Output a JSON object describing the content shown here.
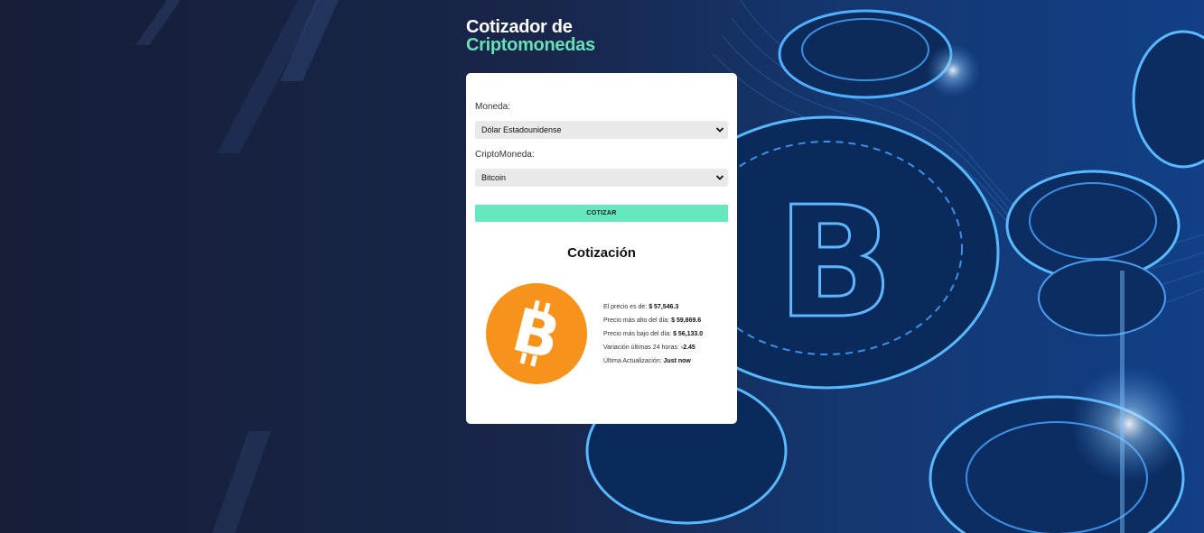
{
  "header": {
    "title_line1": "Cotizador de",
    "title_line2": "Criptomonedas"
  },
  "form": {
    "currency_label": "Moneda:",
    "currency_value": "Dólar Estadounidense",
    "crypto_label": "CriptoMoneda:",
    "crypto_value": "Bitcoin",
    "submit_label": "COTIZAR"
  },
  "result": {
    "title": "Cotización",
    "coin_icon": "bitcoin-icon",
    "price_label": "El precio es de:",
    "price_value": "$ 57,546.3",
    "high_label": "Precio más alto del día:",
    "high_value": "$ 59,869.6",
    "low_label": "Precio más bajo del día:",
    "low_value": "$ 56,133.0",
    "change_label": "Variación últimas 24 horas:",
    "change_value": "-2.45",
    "updated_label": "Última Actualización:",
    "updated_value": "Just now"
  },
  "colors": {
    "accent": "#66e7bd",
    "background": "#151f3a",
    "bitcoin": "#f7931a"
  }
}
